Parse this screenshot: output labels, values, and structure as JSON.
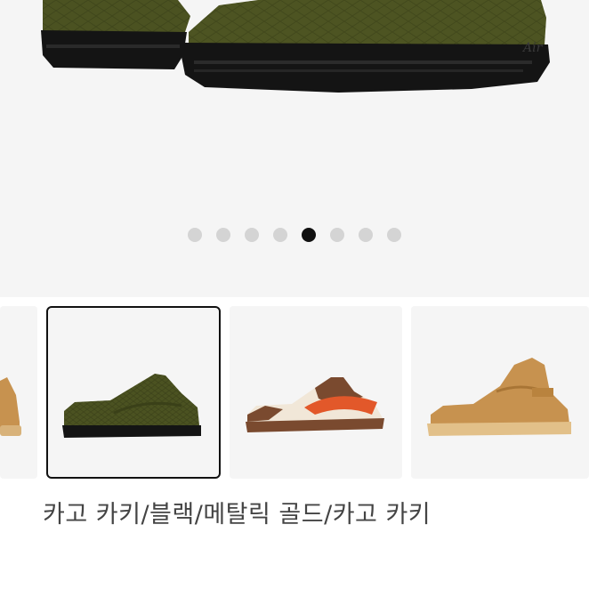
{
  "gallery": {
    "active_index": 4,
    "dot_count": 8,
    "hero_shoe": "olive-croc-sneaker",
    "hero_heel_text": "Air"
  },
  "thumbnails": [
    {
      "name": "wheat-sneaker-partial",
      "selected": false
    },
    {
      "name": "olive-croc-sneaker",
      "selected": true
    },
    {
      "name": "brown-orange-sneaker",
      "selected": false
    },
    {
      "name": "wheat-mid-sneaker",
      "selected": false
    }
  ],
  "colorway": {
    "label": "카고 카키/블랙/메탈릭 골드/카고 카키"
  },
  "colors": {
    "olive": "#4b5221",
    "sole_black": "#141414",
    "wheat": "#c7924f",
    "brown": "#7a4a2f",
    "orange": "#e2582a",
    "dot_inactive": "#d4d4d4",
    "dot_active": "#111111"
  }
}
